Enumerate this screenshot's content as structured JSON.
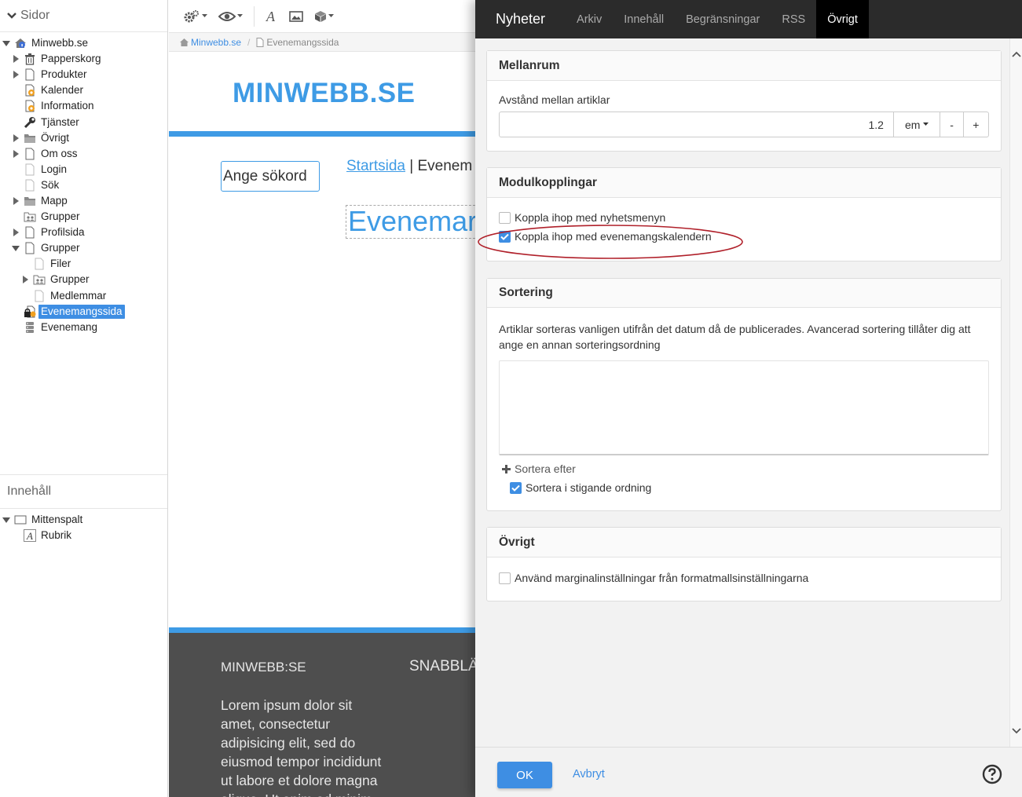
{
  "sidebar": {
    "pages_title": "Sidor",
    "tree": [
      {
        "label": "Minwebb.se",
        "icon": "site-home-icon"
      },
      {
        "label": "Papperskorg",
        "icon": "trash-icon"
      },
      {
        "label": "Produkter",
        "icon": "page-icon"
      },
      {
        "label": "Kalender",
        "icon": "calendar-page-icon"
      },
      {
        "label": "Information",
        "icon": "info-page-icon"
      },
      {
        "label": "Tjänster",
        "icon": "wrench-icon"
      },
      {
        "label": "Övrigt",
        "icon": "folder-icon"
      },
      {
        "label": "Om oss",
        "icon": "page-icon"
      },
      {
        "label": "Login",
        "icon": "page-icon"
      },
      {
        "label": "Sök",
        "icon": "page-icon"
      },
      {
        "label": "Mapp",
        "icon": "folder-icon"
      },
      {
        "label": "Grupper",
        "icon": "group-folder-icon"
      },
      {
        "label": "Profilsida",
        "icon": "page-icon"
      },
      {
        "label": "Grupper",
        "icon": "page-icon"
      },
      {
        "label": "Filer",
        "icon": "page-icon"
      },
      {
        "label": "Grupper",
        "icon": "group-folder-icon"
      },
      {
        "label": "Medlemmar",
        "icon": "page-icon"
      },
      {
        "label": "Evenemangssida",
        "icon": "locked-page-icon"
      },
      {
        "label": "Evenemang",
        "icon": "database-icon"
      }
    ],
    "content_title": "Innehåll",
    "content_tree": [
      {
        "label": "Mittenspalt",
        "icon": "column-icon"
      },
      {
        "label": "Rubrik",
        "icon": "heading-icon"
      }
    ]
  },
  "editor": {
    "toolbar": [
      "settings-icon",
      "preview-icon",
      "text-icon",
      "image-icon",
      "module-icon"
    ],
    "breadcrumb": {
      "home": "Minwebb.se",
      "current": "Evenemangssida"
    },
    "page": {
      "logo": "MINWEBB.SE",
      "search_placeholder": "Ange sökord",
      "nav_link": "Startsida",
      "nav_sep": " | ",
      "nav_current": "Evenem",
      "title": "Evenemar",
      "footer_col1": "MINWEBB:SE",
      "footer_col2": "SNABBLÄ",
      "footer_text": "Lorem ipsum dolor sit amet, consectetur adipisicing elit, sed do eiusmod tempor incididunt ut labore et dolore magna aliqua. Ut enim ad minim"
    }
  },
  "dialog": {
    "tabs": [
      "Nyheter",
      "Arkiv",
      "Innehåll",
      "Begränsningar",
      "RSS",
      "Övrigt"
    ],
    "active_tab": "Övrigt",
    "spacing": {
      "title": "Mellanrum",
      "label": "Avstånd mellan artiklar",
      "value": "1.2",
      "unit": "em",
      "minus": "-",
      "plus": "+"
    },
    "modules": {
      "title": "Modulkopplingar",
      "news_menu_label": "Koppla ihop med nyhetsmenyn",
      "news_menu_checked": false,
      "event_calendar_label": "Koppla ihop med evenemangskalendern",
      "event_calendar_checked": true
    },
    "sorting": {
      "title": "Sortering",
      "description": "Artiklar sorteras vanligen utifrån det datum då de publicerades. Avancerad sortering tillåter dig att ange en annan sorteringsordning",
      "add_label": "Sortera efter",
      "ascending_label": "Sortera i stigande ordning",
      "ascending_checked": true
    },
    "other": {
      "title": "Övrigt",
      "margin_label": "Använd marginalinställningar från formatmallsinställningarna",
      "margin_checked": false
    },
    "footer": {
      "ok": "OK",
      "cancel": "Avbryt"
    }
  },
  "colors": {
    "accent": "#3e8ee3",
    "site_blue": "#3e9be5",
    "highlight_ring": "#b0202a",
    "dark_tabs": "#2b2b2b"
  }
}
